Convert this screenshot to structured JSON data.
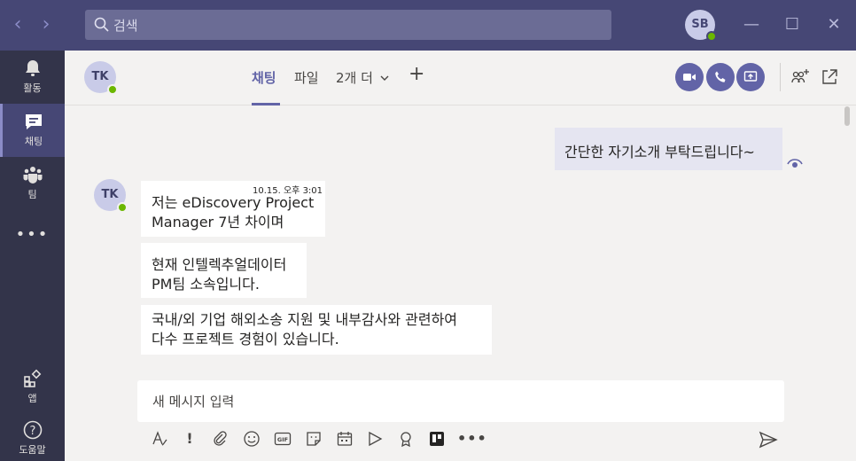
{
  "titlebar": {
    "back_icon": "chevron-left-icon",
    "forward_icon": "chevron-right-icon",
    "search_placeholder": "검색",
    "user_initials": "SB",
    "minimize_icon": "minimize-icon",
    "maximize_icon": "maximize-icon",
    "close_icon": "close-icon"
  },
  "rail": {
    "items": [
      {
        "label": "활동",
        "icon": "bell-icon"
      },
      {
        "label": "채팅",
        "icon": "chat-icon"
      },
      {
        "label": "팀",
        "icon": "teams-icon"
      },
      {
        "label": "앱",
        "icon": "apps-icon"
      },
      {
        "label": "도움말",
        "icon": "help-icon"
      }
    ],
    "more_label": "•••"
  },
  "header": {
    "contact_initials": "TK",
    "tabs": [
      {
        "label": "채팅",
        "active": true
      },
      {
        "label": "파일",
        "active": false
      },
      {
        "label": "2개 더",
        "active": false
      }
    ],
    "add_tab_label": "+",
    "actions": [
      "video-call-icon",
      "audio-call-icon",
      "share-screen-icon",
      "add-people-icon",
      "pop-out-icon"
    ]
  },
  "messages": {
    "mine": {
      "text": "간단한 자기소개 부탁드립니다~",
      "seen_icon": "eye-icon"
    },
    "theirs": {
      "sender_initials": "TK",
      "timestamp": "10.15. 오후 3:01",
      "bubbles": [
        {
          "line1": "저는 eDiscovery Project",
          "line2": "Manager 7년 차이며"
        },
        {
          "line1": "현재 인텔렉추얼데이터",
          "line2": "PM팀 소속입니다."
        },
        {
          "line1": "국내/외 기업 해외소송 지원 및 내부감사와 관련하여",
          "line2": "다수 프로젝트 경험이 있습니다."
        }
      ]
    }
  },
  "compose": {
    "placeholder": "새 메시지 입력",
    "tools": [
      "format-icon",
      "important-icon",
      "attach-icon",
      "emoji-icon",
      "gif-icon",
      "sticker-icon",
      "schedule-meeting-icon",
      "stream-icon",
      "praise-icon",
      "trello-icon",
      "more-icon"
    ],
    "gif_label": "GIF",
    "send_icon": "send-icon"
  },
  "colors": {
    "titlebar": "#464775",
    "rail": "#33344a",
    "accent": "#6264a7",
    "presence": "#6bb700"
  }
}
